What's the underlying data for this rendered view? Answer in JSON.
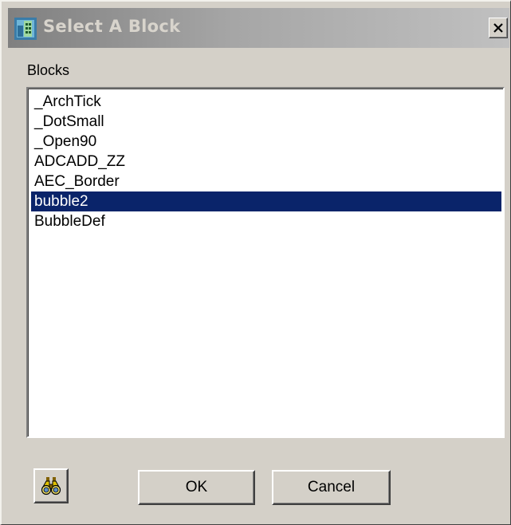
{
  "window": {
    "title": "Select A Block",
    "close_glyph": "×"
  },
  "icons": {
    "app": "block-app-icon",
    "close": "close-icon",
    "finder": "binoculars-icon"
  },
  "blocks": {
    "label": "Blocks",
    "items": [
      {
        "label": "_ArchTick",
        "selected": false
      },
      {
        "label": "_DotSmall",
        "selected": false
      },
      {
        "label": "_Open90",
        "selected": false
      },
      {
        "label": "ADCADD_ZZ",
        "selected": false
      },
      {
        "label": "AEC_Border",
        "selected": false
      },
      {
        "label": "bubble2",
        "selected": true
      },
      {
        "label": "BubbleDef",
        "selected": false
      }
    ]
  },
  "buttons": {
    "ok_label": "OK",
    "cancel_label": "Cancel"
  },
  "colors": {
    "dialog_face": "#d4d0c8",
    "selection": "#0a246a",
    "selection_text": "#ffffff",
    "inactive_title_start": "#808080",
    "inactive_title_end": "#c0c0c0"
  }
}
